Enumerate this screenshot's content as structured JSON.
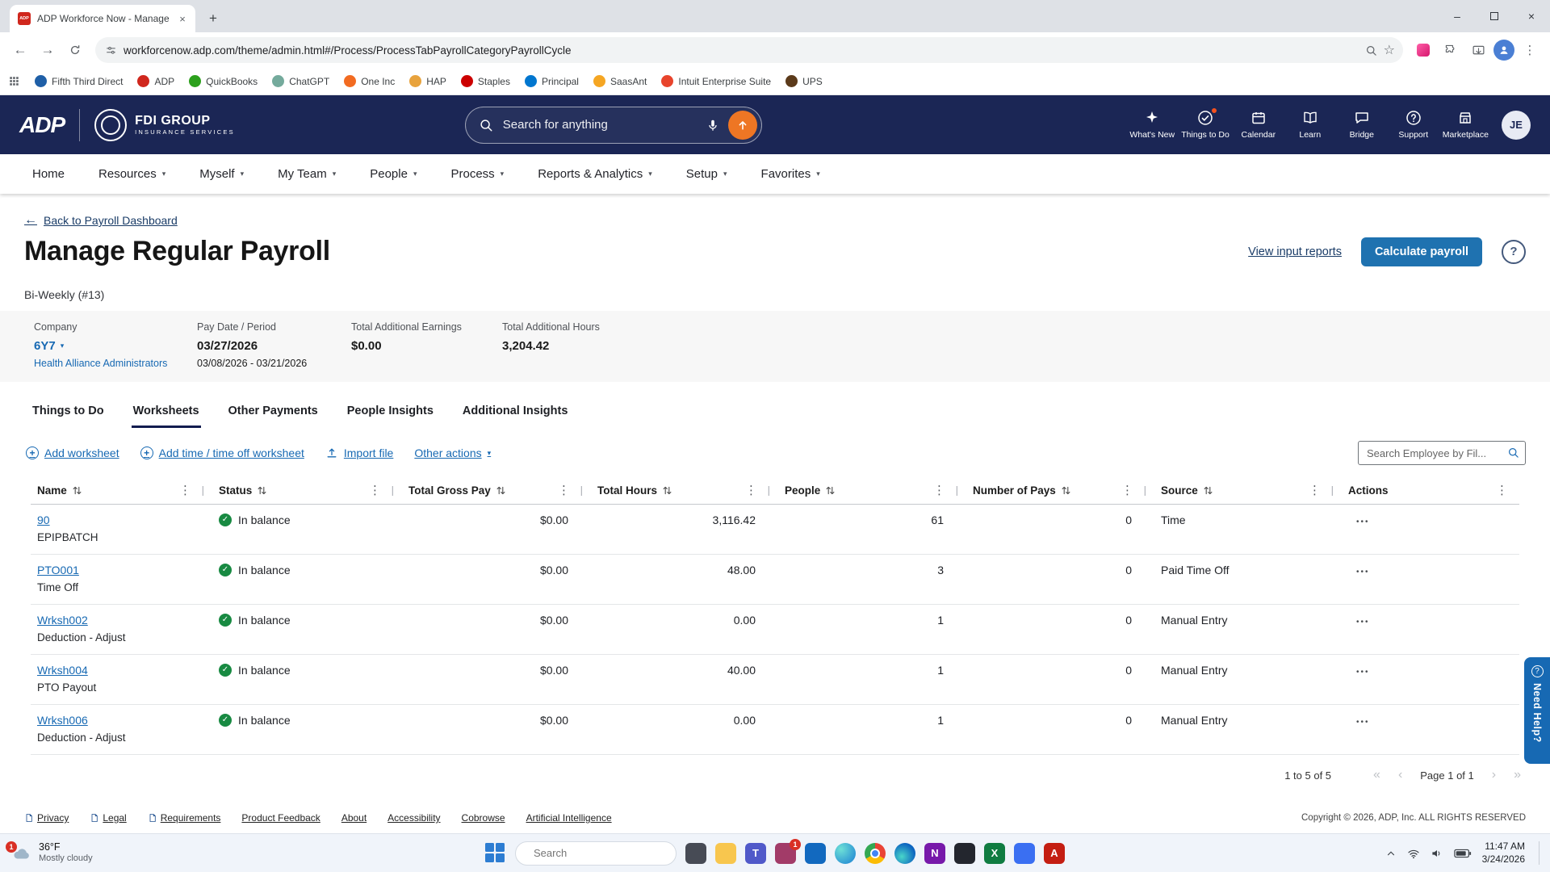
{
  "browser": {
    "tab_title": "ADP Workforce Now - Manage",
    "url": "workforcenow.adp.com/theme/admin.html#/Process/ProcessTabPayrollCategoryPayrollCycle",
    "bookmarks": [
      {
        "label": "Fifth Third Direct",
        "color": "#1f5fa7"
      },
      {
        "label": "ADP",
        "color": "#d0271d"
      },
      {
        "label": "QuickBooks",
        "color": "#2ca01c"
      },
      {
        "label": "ChatGPT",
        "color": "#74aa9c"
      },
      {
        "label": "One Inc",
        "color": "#f26b21"
      },
      {
        "label": "HAP",
        "color": "#e8a33d"
      },
      {
        "label": "Staples",
        "color": "#cc0000"
      },
      {
        "label": "Principal",
        "color": "#0076cf"
      },
      {
        "label": "SaasAnt",
        "color": "#f5a623"
      },
      {
        "label": "Intuit Enterprise Suite",
        "color": "#e8442c"
      },
      {
        "label": "UPS",
        "color": "#5b3a1a"
      }
    ]
  },
  "header": {
    "logo": "ADP",
    "brand": "FDI GROUP",
    "brand_sub": "INSURANCE SERVICES",
    "search_placeholder": "Search for anything",
    "icons": [
      {
        "label": "What's New"
      },
      {
        "label": "Things to Do",
        "badge": true
      },
      {
        "label": "Calendar"
      },
      {
        "label": "Learn"
      },
      {
        "label": "Bridge"
      },
      {
        "label": "Support"
      },
      {
        "label": "Marketplace"
      }
    ],
    "avatar": "JE"
  },
  "nav": {
    "items": [
      "Home",
      "Resources",
      "Myself",
      "My Team",
      "People",
      "Process",
      "Reports & Analytics",
      "Setup",
      "Favorites"
    ]
  },
  "page": {
    "back_link": "Back to Payroll Dashboard",
    "title": "Manage Regular Payroll",
    "view_reports_link": "View input reports",
    "calculate_button": "Calculate payroll",
    "cycle_label": "Bi-Weekly (#13)",
    "summary": {
      "company_label": "Company",
      "company_code": "6Y7",
      "company_name": "Health Alliance Administrators",
      "pay_date_label": "Pay Date / Period",
      "pay_date": "03/27/2026",
      "pay_period": "03/08/2026 - 03/21/2026",
      "earnings_label": "Total Additional Earnings",
      "earnings_value": "$0.00",
      "hours_label": "Total Additional Hours",
      "hours_value": "3,204.42"
    },
    "tabs": [
      "Things to Do",
      "Worksheets",
      "Other Payments",
      "People Insights",
      "Additional Insights"
    ],
    "active_tab": "Worksheets",
    "toolbar": {
      "add_worksheet": "Add worksheet",
      "add_time_worksheet": "Add time / time off worksheet",
      "import_file": "Import file",
      "other_actions": "Other actions",
      "search_placeholder": "Search Employee by Fil..."
    },
    "table": {
      "columns": [
        "Name",
        "Status",
        "Total Gross Pay",
        "Total Hours",
        "People",
        "Number of Pays",
        "Source",
        "Actions"
      ],
      "rows": [
        {
          "name": "90",
          "sub": "EPIPBATCH",
          "status": "In balance",
          "gross": "$0.00",
          "hours": "3,116.42",
          "people": "61",
          "pays": "0",
          "source": "Time"
        },
        {
          "name": "PTO001",
          "sub": "Time Off",
          "status": "In balance",
          "gross": "$0.00",
          "hours": "48.00",
          "people": "3",
          "pays": "0",
          "source": "Paid Time Off"
        },
        {
          "name": "Wrksh002",
          "sub": "Deduction - Adjust",
          "status": "In balance",
          "gross": "$0.00",
          "hours": "0.00",
          "people": "1",
          "pays": "0",
          "source": "Manual Entry"
        },
        {
          "name": "Wrksh004",
          "sub": "PTO Payout",
          "status": "In balance",
          "gross": "$0.00",
          "hours": "40.00",
          "people": "1",
          "pays": "0",
          "source": "Manual Entry"
        },
        {
          "name": "Wrksh006",
          "sub": "Deduction - Adjust",
          "status": "In balance",
          "gross": "$0.00",
          "hours": "0.00",
          "people": "1",
          "pays": "0",
          "source": "Manual Entry"
        }
      ]
    },
    "pagination": {
      "range_text": "1 to 5 of 5",
      "page_text": "Page 1 of 1"
    },
    "need_help": "Need Help?"
  },
  "footer": {
    "links": [
      "Privacy",
      "Legal",
      "Requirements",
      "Product Feedback",
      "About",
      "Accessibility",
      "Cobrowse",
      "Artificial Intelligence"
    ],
    "copyright": "Copyright © 2026, ADP, Inc. ALL RIGHTS RESERVED"
  },
  "taskbar": {
    "weather": {
      "temp": "36°F",
      "desc": "Mostly cloudy",
      "badge": "1"
    },
    "search_placeholder": "Search",
    "apps": [
      {
        "name": "files-dark",
        "color": "#474b55"
      },
      {
        "name": "file-explorer",
        "color": "#f8c64e"
      },
      {
        "name": "teams",
        "color": "#5059c9"
      },
      {
        "name": "app-with-badge",
        "color": "#a23b68",
        "badge": "1"
      },
      {
        "name": "outlook",
        "color": "#1269bf"
      },
      {
        "name": "copilot",
        "color": "radial-gradient(circle at 30% 30%, #6ee0d6, #1a7fd4)"
      },
      {
        "name": "chrome",
        "color": "conic-gradient(#ea4335 0deg 120deg, #fbbc05 120deg 240deg, #34a853 240deg 360deg)"
      },
      {
        "name": "edge",
        "color": "radial-gradient(circle at 35% 65%, #49d6c9, #0c64c0 70%)"
      },
      {
        "name": "onenote",
        "color": "#7719aa"
      },
      {
        "name": "notepad",
        "color": "#23262e"
      },
      {
        "name": "excel",
        "color": "#107c41"
      },
      {
        "name": "calculator",
        "color": "#3a6ff2"
      },
      {
        "name": "acrobat",
        "color": "#c41e12"
      }
    ],
    "clock": {
      "time": "11:47 AM",
      "date": "3/24/2026"
    }
  },
  "colors": {
    "header_navy": "#1b2655",
    "link_blue": "#1769b3",
    "button_blue": "#1f72b0",
    "success_green": "#188a42",
    "accent_orange": "#ee7624"
  }
}
